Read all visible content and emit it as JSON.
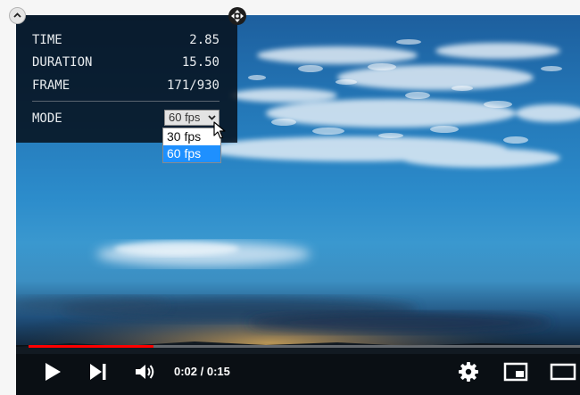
{
  "overlay": {
    "rows": [
      {
        "key": "TIME",
        "value": "2.85"
      },
      {
        "key": "DURATION",
        "value": "15.50"
      },
      {
        "key": "FRAME",
        "value": "171/930"
      }
    ],
    "mode": {
      "label": "MODE",
      "selected": "60 fps",
      "options": [
        "30 fps",
        "60 fps"
      ]
    }
  },
  "player": {
    "time_display": "0:02 / 0:15",
    "progress_fraction": 0.2258
  },
  "icons": {
    "overlay_toggle": "chevron-up-icon",
    "move_handle": "move-icon",
    "play": "play-icon",
    "next": "next-icon",
    "volume": "volume-icon",
    "settings": "gear-icon",
    "miniplayer": "miniplayer-icon",
    "theater": "theater-mode-icon"
  },
  "colors": {
    "progress": "#ff0000",
    "selected_option": "#1e90ff"
  }
}
